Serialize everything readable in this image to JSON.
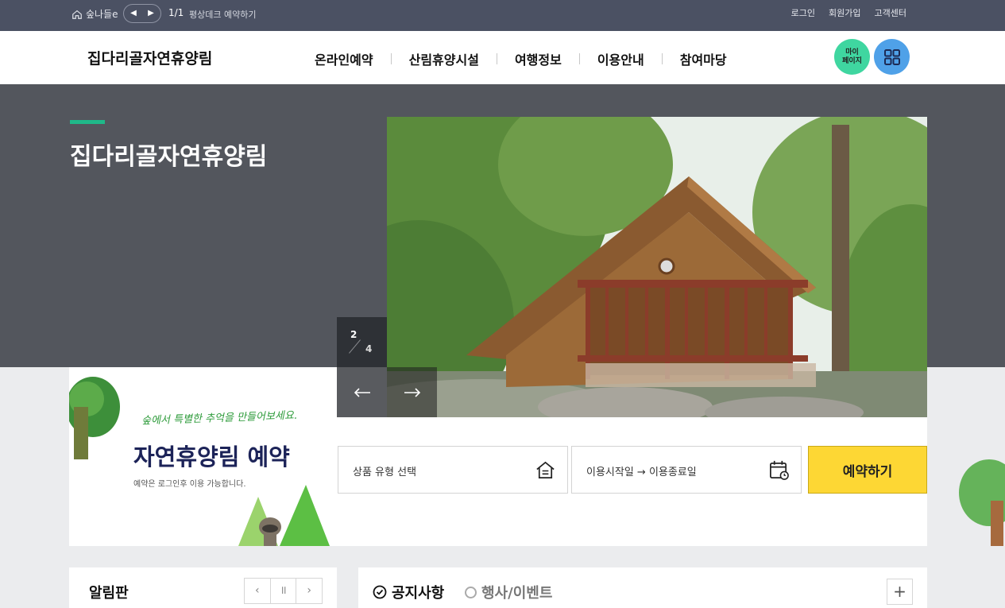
{
  "utilbar": {
    "home_label": "숲나들e",
    "page_count": "1/1",
    "notice": "평상데크 예약하기",
    "links": [
      "로그인",
      "회원가입",
      "고객센터"
    ]
  },
  "header": {
    "logo": "집다리골자연휴양림",
    "nav": [
      "온라인예약",
      "산림휴양시설",
      "여행정보",
      "이용안내",
      "참여마당"
    ],
    "mypage_label": "마이\n페이지"
  },
  "hero": {
    "title": "집다리골자연휴양림",
    "slide_current": "2",
    "slide_total": "4"
  },
  "reservation": {
    "script_text": "숲에서 특별한 추억을 만들어보세요.",
    "title": "자연휴양림 예약",
    "subtitle": "예약은 로그인후 이용 가능합니다.",
    "type_placeholder": "상품 유형 선택",
    "date_placeholder": "이용시작일 → 이용종료일",
    "button": "예약하기"
  },
  "boards": {
    "left_title": "알림판",
    "tabs": [
      "공지사항",
      "행사/이벤트"
    ]
  },
  "colors": {
    "utilbar": "#4b5163",
    "hero_bg": "#53565d",
    "accent_green": "#1fb889",
    "reserve_yellow": "#fdd734",
    "mypage_green": "#3fd6a0",
    "menu_blue": "#4fa1e8"
  }
}
